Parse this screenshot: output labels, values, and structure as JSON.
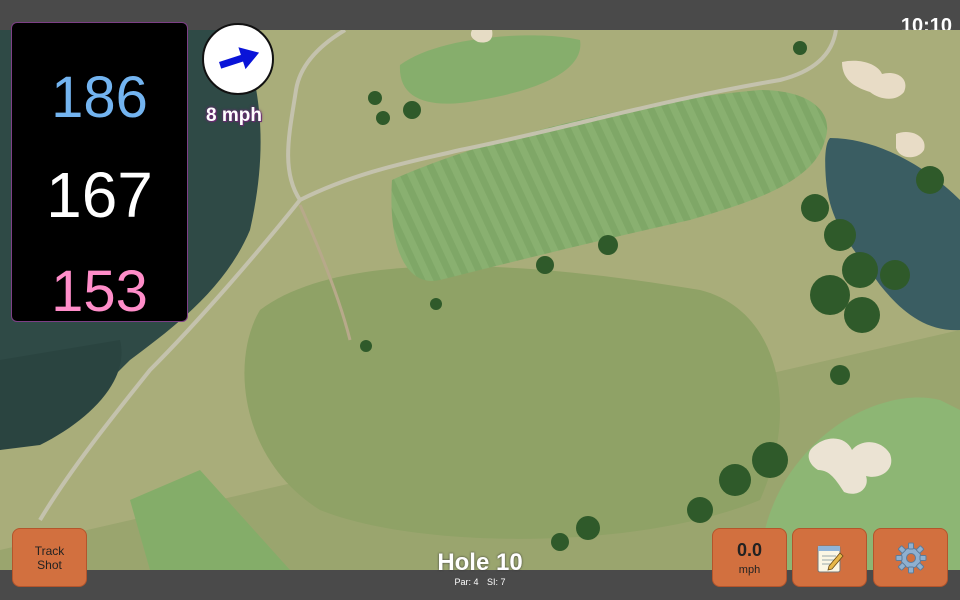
{
  "status_bar": {
    "time": "10:10"
  },
  "yardage": {
    "back": "186",
    "center": "167",
    "front": "153"
  },
  "wind": {
    "speed": "8 mph",
    "arrow_color": "#0a14d8",
    "icon": "wind-arrow-icon"
  },
  "hole": {
    "title": "Hole 10",
    "par": "Par: 4",
    "stroke_index": "SI: 7"
  },
  "buttons": {
    "track_shot_line1": "Track",
    "track_shot_line2": "Shot",
    "speed_value": "0.0",
    "speed_unit": "mph",
    "notes_icon": "notepad-icon",
    "settings_icon": "gear-icon"
  },
  "colors": {
    "button_orange": "#d2703f",
    "back_yardage": "#73b4f0",
    "front_yardage": "#ff8dc9",
    "bar_gray": "#4a4a4a"
  }
}
